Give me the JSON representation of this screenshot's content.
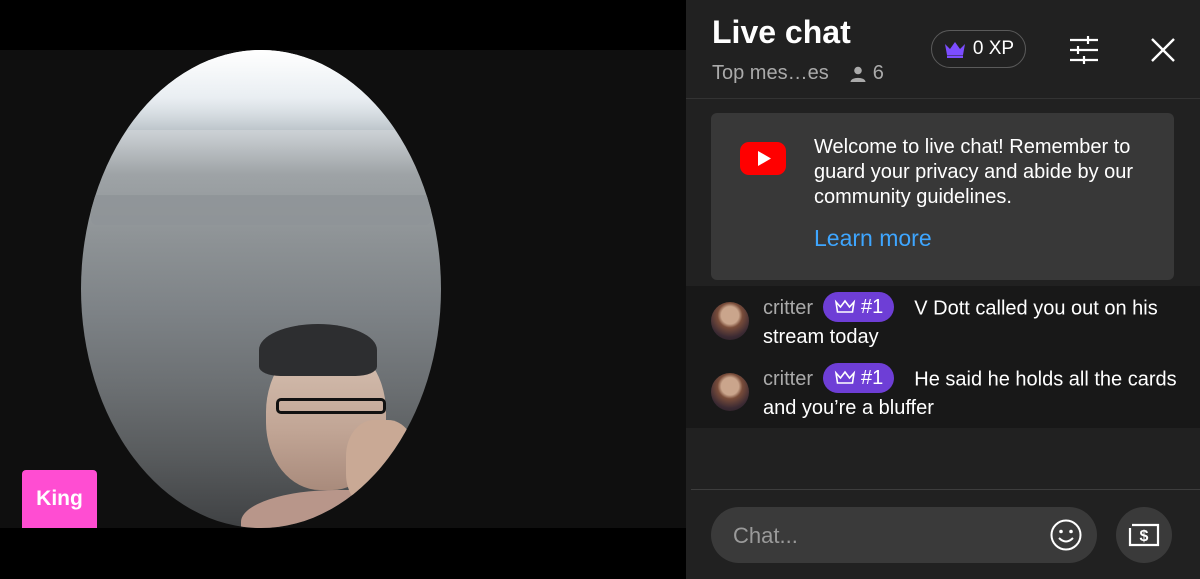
{
  "video": {
    "streamer_tag": "King",
    "tag_color": "#ff4dd2"
  },
  "chat": {
    "title": "Live chat",
    "mode_label": "Top mes…es",
    "viewer_count": "6",
    "xp_label": "0 XP",
    "icons": {
      "viewers": "person-icon",
      "xp": "crown-icon",
      "settings": "sliders-icon",
      "close": "close-icon"
    },
    "welcome": {
      "message": "Welcome to live chat! Remember to guard your privacy and abide by our community guidelines.",
      "link": "Learn more",
      "logo": "youtube-logo"
    },
    "messages": [
      {
        "author": "critter",
        "badge": "#1",
        "text": "V Dott called you out on his stream today"
      },
      {
        "author": "critter",
        "badge": "#1",
        "text": "He said he holds all the cards and you’re a bluffer"
      }
    ],
    "input": {
      "placeholder": "Chat...",
      "emoji_icon": "smiley-icon",
      "super_chat_icon": "dollar-bill-icon"
    },
    "colors": {
      "panel_bg": "#212121",
      "link": "#3ea6ff",
      "badge": "#6e3ed6",
      "youtube_red": "#ff0000"
    }
  }
}
